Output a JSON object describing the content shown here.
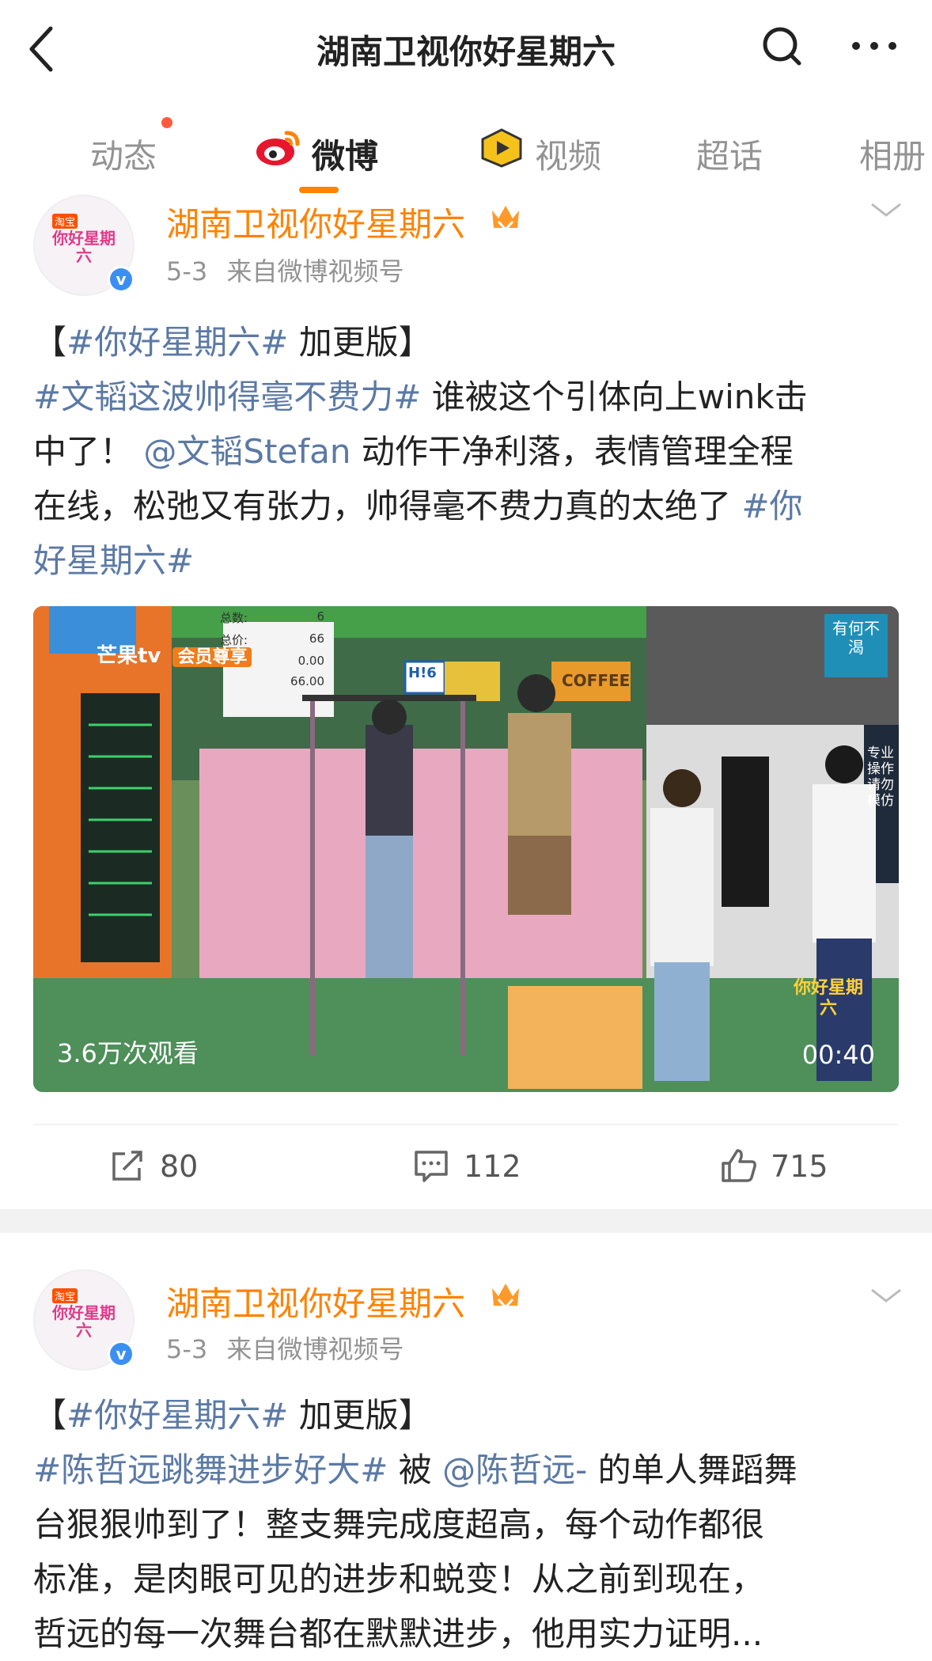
{
  "header": {
    "title": "湖南卫视你好星期六"
  },
  "tabs": [
    {
      "label": "动态"
    },
    {
      "label": "微博"
    },
    {
      "label": "视频"
    },
    {
      "label": "超话"
    },
    {
      "label": "相册"
    }
  ],
  "active_tab": "微博",
  "posts": [
    {
      "author": "湖南卫视你好星期六",
      "date": "5-3",
      "source": "来自微博视频号",
      "avatar_text": "你好星期六",
      "avatar_small": "淘宝",
      "body": [
        [
          {
            "t": "【"
          },
          {
            "t": "#你好星期六#",
            "tag": true
          },
          {
            "t": " 加更版】"
          }
        ],
        [
          {
            "t": "#文韬这波帅得毫不费力#",
            "tag": true
          },
          {
            "t": " 谁被这个引体向上wink击"
          }
        ],
        [
          {
            "t": "中了！ "
          },
          {
            "t": "@文韬Stefan",
            "tag": true
          },
          {
            "t": " 动作干净利落，表情管理全程"
          }
        ],
        [
          {
            "t": "在线，松弛又有张力，帅得毫不费力真的太绝了 "
          },
          {
            "t": "#你",
            "tag": true
          }
        ],
        [
          {
            "t": "好星期六#",
            "tag": true
          }
        ]
      ],
      "video": {
        "views": "3.6万次观看",
        "duration": "00:40",
        "scene_texts": {
          "mango": "芒果tv",
          "vip": "会员尊享",
          "sign": "H!6",
          "coffee": "COFFEE",
          "corner": "有何不渴",
          "side_note": "专业操作 请勿模仿",
          "logo": "你好星期六",
          "receipt": [
            "总数:",
            "总价:"
          ],
          "receipt_values": [
            "6",
            "66",
            "0.00",
            "66.00"
          ]
        }
      },
      "actions": {
        "repost": "80",
        "comment": "112",
        "like": "715"
      }
    },
    {
      "author": "湖南卫视你好星期六",
      "date": "5-3",
      "source": "来自微博视频号",
      "avatar_text": "你好星期六",
      "avatar_small": "淘宝",
      "body": [
        [
          {
            "t": "【"
          },
          {
            "t": "#你好星期六#",
            "tag": true
          },
          {
            "t": " 加更版】"
          }
        ],
        [
          {
            "t": "#陈哲远跳舞进步好大#",
            "tag": true
          },
          {
            "t": " 被 "
          },
          {
            "t": "@陈哲远-",
            "tag": true
          },
          {
            "t": " 的单人舞蹈舞"
          }
        ],
        [
          {
            "t": "台狠狠帅到了！整支舞完成度超高，每个动作都很"
          }
        ],
        [
          {
            "t": "标准，是肉眼可见的进步和蜕变！从之前到现在，"
          }
        ],
        [
          {
            "t": "哲远的每一次舞台都在默默进步，他用实力证明..."
          }
        ]
      ]
    }
  ],
  "colors": {
    "accent": "#ff8200",
    "tag": "#5b79a5",
    "muted": "#939393",
    "verified": "#3b8ff2",
    "notification_dot": "#ff5a3d"
  },
  "icons": [
    "back-icon",
    "search-icon",
    "more-icon",
    "weibo-logo-icon",
    "video-icon",
    "repost-icon",
    "comment-icon",
    "like-icon",
    "chevron-down-icon",
    "verified-icon",
    "crown-icon"
  ]
}
